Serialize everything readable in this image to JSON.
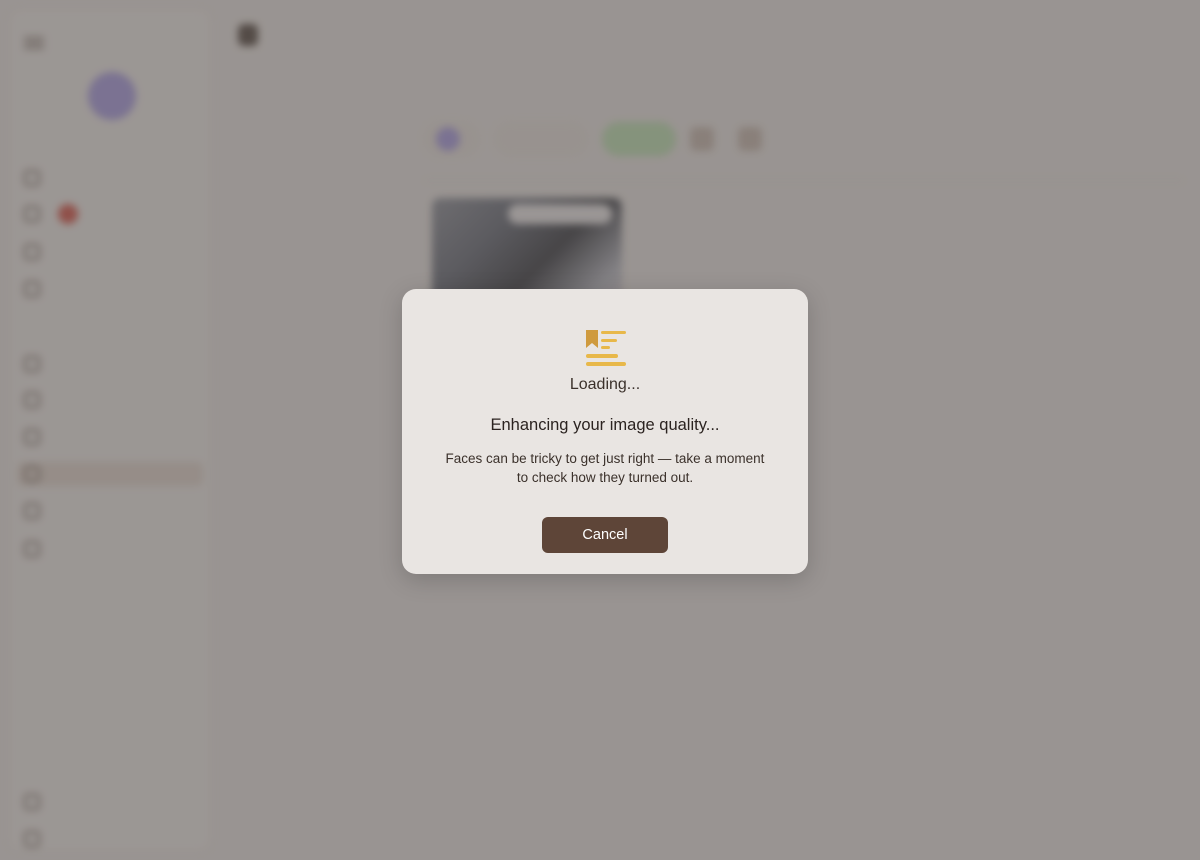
{
  "modal": {
    "loading_label": "Loading...",
    "title": "Enhancing your image quality...",
    "body": "Faces can be tricky to get just right — take a moment to check how they turned out.",
    "cancel_label": "Cancel",
    "icon": "document-loading-icon",
    "accent_color": "#e8b84a",
    "button_color": "#5e4538"
  },
  "colors": {
    "overlay": "#5c5654",
    "modal_bg": "#e9e5e2"
  }
}
